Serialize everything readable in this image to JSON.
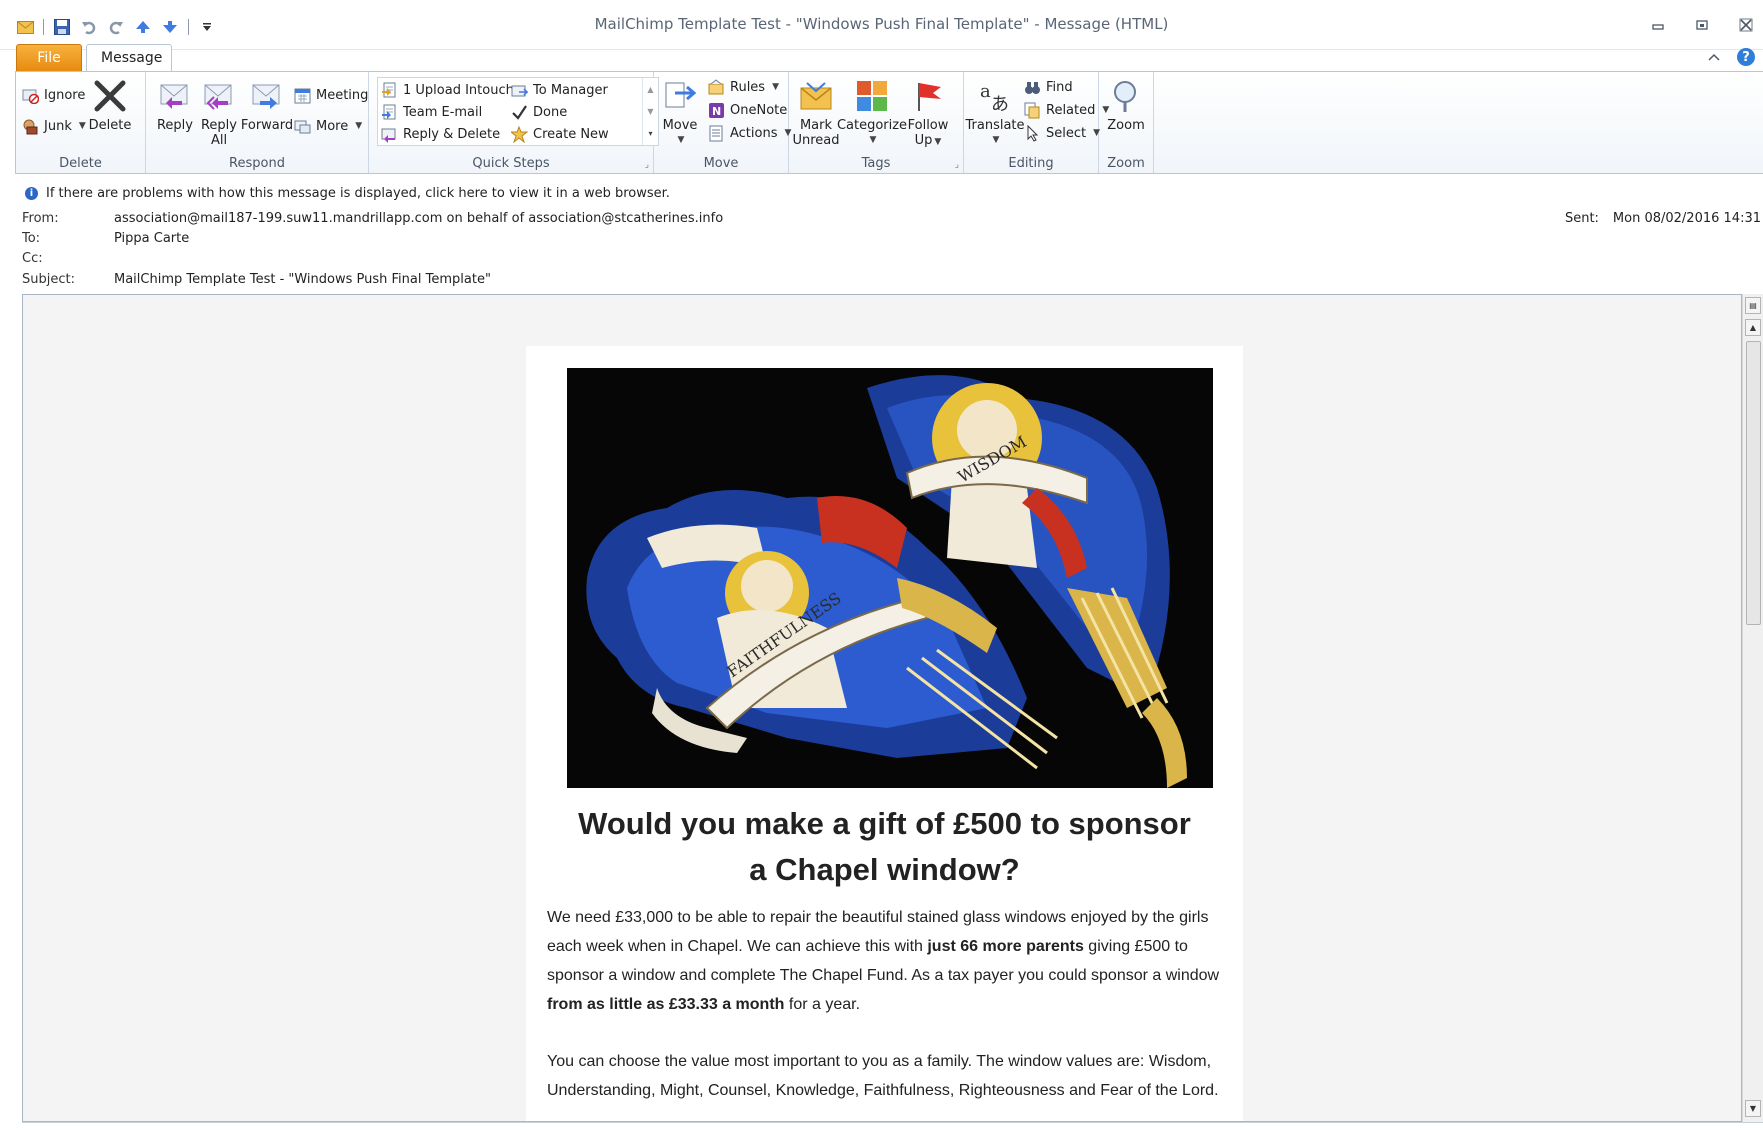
{
  "window": {
    "title": "MailChimp Template Test - \"Windows Push Final Template\"  -  Message (HTML)"
  },
  "tabs": {
    "file": "File",
    "message": "Message"
  },
  "ribbon": {
    "delete_group": {
      "label": "Delete",
      "ignore": "Ignore",
      "junk": "Junk",
      "delete": "Delete"
    },
    "respond_group": {
      "label": "Respond",
      "reply": "Reply",
      "reply_all_1": "Reply",
      "reply_all_2": "All",
      "forward": "Forward",
      "meeting": "Meeting",
      "more": "More"
    },
    "quick_steps_group": {
      "label": "Quick Steps",
      "items": [
        "1 Upload Intouch",
        "To Manager",
        "Team E-mail",
        "Done",
        "Reply & Delete",
        "Create New"
      ]
    },
    "move_group": {
      "label": "Move",
      "move": "Move",
      "rules": "Rules",
      "onenote": "OneNote",
      "actions": "Actions"
    },
    "tags_group": {
      "label": "Tags",
      "mark_unread_1": "Mark",
      "mark_unread_2": "Unread",
      "categorize": "Categorize",
      "follow_up_1": "Follow",
      "follow_up_2": "Up"
    },
    "editing_group": {
      "label": "Editing",
      "translate": "Translate",
      "find": "Find",
      "related": "Related",
      "select": "Select"
    },
    "zoom_group": {
      "label": "Zoom",
      "zoom": "Zoom"
    }
  },
  "info_bar": {
    "text": "If there are problems with how this message is displayed, click here to view it in a web browser."
  },
  "header": {
    "from_label": "From:",
    "from_value": "association@mail187-199.suw11.mandrillapp.com on behalf of association@stcatherines.info",
    "to_label": "To:",
    "to_value": "Pippa Carte",
    "cc_label": "Cc:",
    "subject_label": "Subject:",
    "subject_value": "MailChimp Template Test - \"Windows Push Final Template\"",
    "sent_label": "Sent:",
    "sent_value": "Mon 08/02/2016 14:31"
  },
  "email": {
    "hero_alt": "stained glass window",
    "banner_words": [
      "FAITHFULNESS",
      "WISDOM"
    ],
    "headline_line1": "Would you make a gift of £500 to sponsor",
    "headline_line2": "a Chapel window?",
    "p1_a": "We need £33,000 to be able to repair the beautiful stained glass windows enjoyed by the girls each week when in Chapel.  We can achieve this with ",
    "p1_b": "just 66 more parents",
    "p1_c": " giving £500 to sponsor a window and complete The Chapel Fund.  As a tax payer you could sponsor a window ",
    "p1_d": "from as little as £33.33 a month",
    "p1_e": " for a year.",
    "p2": "You can choose the value most important to you as a family.  The window values are: Wisdom, Understanding, Might, Counsel, Knowledge, Faithfulness, Righteousness and Fear of the Lord."
  },
  "colors": {
    "file_tab": "#e98b12",
    "ribbon_border": "#b9c6d6",
    "info_icon": "#2b67c6"
  }
}
